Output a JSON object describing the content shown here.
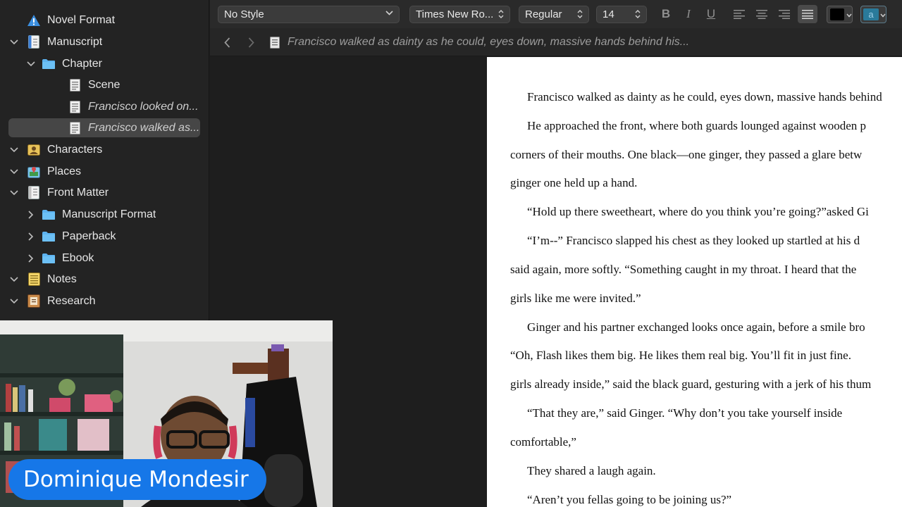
{
  "sidebar": {
    "items": [
      {
        "label": "Novel Format",
        "icon": "warning-icon",
        "expanded": null
      },
      {
        "label": "Manuscript",
        "icon": "manuscript-icon",
        "expanded": true
      },
      {
        "label": "Chapter",
        "icon": "folder-icon",
        "expanded": true
      },
      {
        "label": "Scene",
        "icon": "document-icon",
        "expanded": null
      },
      {
        "label": "Francisco looked on...",
        "icon": "document-icon",
        "expanded": null
      },
      {
        "label": "Francisco walked as...",
        "icon": "document-icon",
        "expanded": null,
        "selected": true
      },
      {
        "label": "Characters",
        "icon": "characters-icon",
        "expanded": true
      },
      {
        "label": "Places",
        "icon": "places-icon",
        "expanded": true
      },
      {
        "label": "Front Matter",
        "icon": "front-matter-icon",
        "expanded": true
      },
      {
        "label": "Manuscript Format",
        "icon": "folder-icon",
        "expanded": false
      },
      {
        "label": "Paperback",
        "icon": "folder-icon",
        "expanded": false
      },
      {
        "label": "Ebook",
        "icon": "folder-icon",
        "expanded": false
      },
      {
        "label": "Notes",
        "icon": "notes-icon",
        "expanded": true
      },
      {
        "label": "Research",
        "icon": "research-icon",
        "expanded": true
      }
    ]
  },
  "toolbar": {
    "style": "No Style",
    "font_family": "Times New Ro...",
    "font_weight": "Regular",
    "font_size": "14",
    "bold": "B",
    "italic": "I",
    "underline": "U",
    "highlight_glyph": "a",
    "text_color": "#000000",
    "highlight_color": "#2a7a9a"
  },
  "header": {
    "doc_title": "Francisco walked as dainty as he could, eyes down, massive hands behind his..."
  },
  "document": {
    "lines": [
      "Francisco walked as dainty as he could, eyes down, massive hands behind",
      "He approached the front, where both guards lounged against wooden p",
      "corners of their mouths. One black—one ginger, they passed a glare betw",
      "ginger one held up a hand.",
      "“Hold up there sweetheart, where do you think you’re going?”asked Gi",
      "“I’m--” Francisco slapped his chest as they looked up startled at his d",
      "said again, more softly. “Something caught in my throat. I heard that the",
      "girls like me were invited.”",
      "Ginger and his partner exchanged looks once again, before a smile bro",
      "“Oh, Flash likes them big. He likes them real big. You’ll fit in just fine.",
      "girls already inside,” said the black guard, gesturing with a jerk of his thum",
      "“That they are,” said Ginger. “Why don’t you take yourself inside",
      "comfortable,”",
      "They shared a laugh again.",
      "“Aren’t you fellas going to be joining us?”"
    ]
  },
  "overlay": {
    "presenter_name": "Dominique Mondesir",
    "accent_color": "#1677e8"
  }
}
